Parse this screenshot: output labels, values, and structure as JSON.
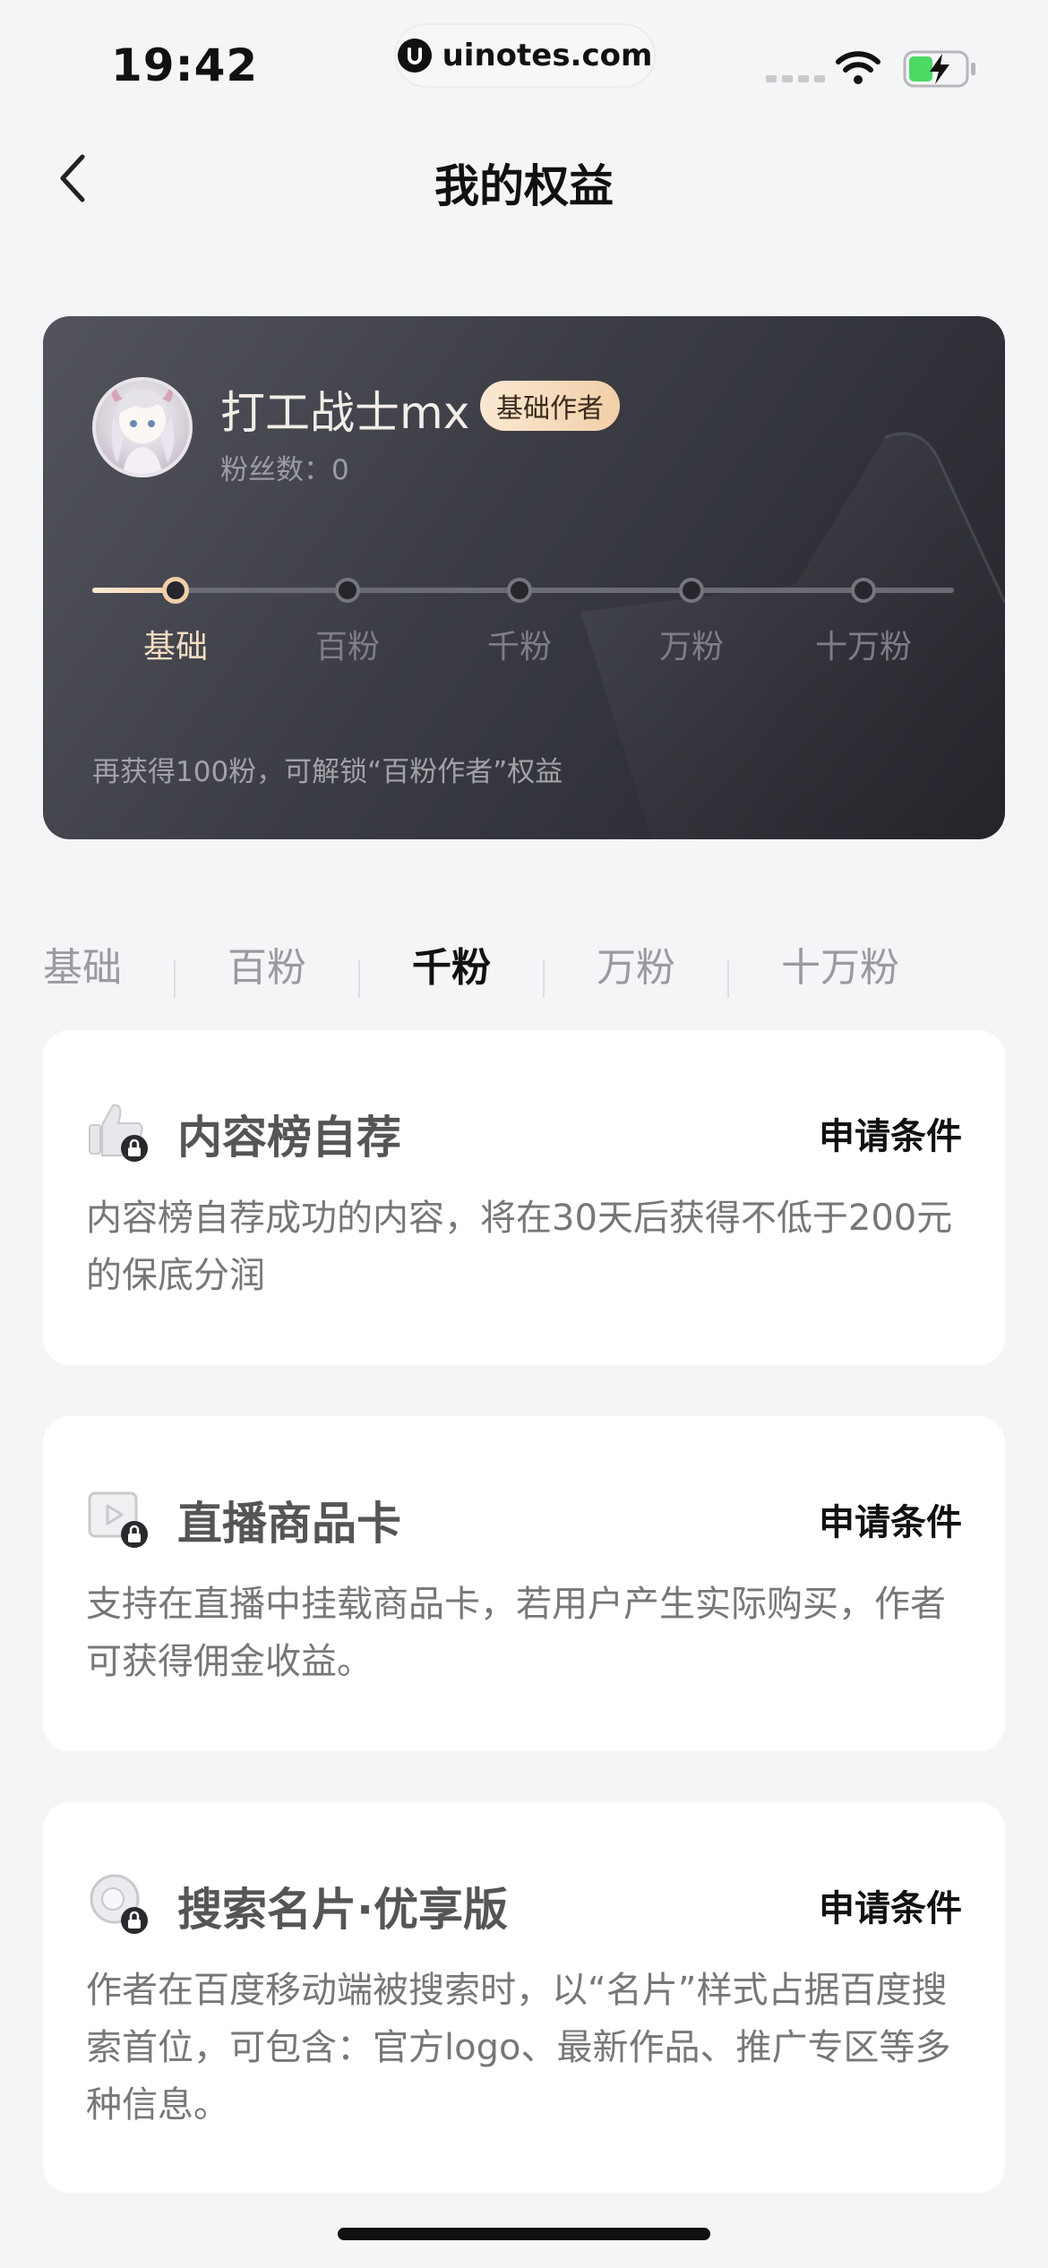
{
  "status_bar": {
    "time": "19:42",
    "url": "uinotes.com"
  },
  "nav": {
    "title": "我的权益"
  },
  "profile": {
    "name": "打工战士mx",
    "badge": "基础作者",
    "fans_label": "粉丝数：",
    "fans_count": "0",
    "progress_fraction": 0.1,
    "levels": [
      "基础",
      "百粉",
      "千粉",
      "万粉",
      "十万粉"
    ],
    "current_level_index": 0,
    "hint": "再获得100粉，可解锁“百粉作者”权益"
  },
  "tabs": {
    "items": [
      "基础",
      "百粉",
      "千粉",
      "万粉",
      "十万粉"
    ],
    "active_index": 2
  },
  "benefits": [
    {
      "icon": "thumbs-up-lock-icon",
      "title": "内容榜自荐",
      "action": "申请条件",
      "description": "内容榜自荐成功的内容，将在30天后获得不低于200元的保底分润"
    },
    {
      "icon": "live-play-lock-icon",
      "title": "直播商品卡",
      "action": "申请条件",
      "description": "支持在直播中挂载商品卡，若用户产生实际购买，作者可获得佣金收益。"
    },
    {
      "icon": "search-card-lock-icon",
      "title": "搜索名片·优享版",
      "action": "申请条件",
      "description": "作者在百度移动端被搜索时，以“名片”样式占据百度搜索首位，可包含：官方logo、最新作品、推广专区等多种信息。"
    }
  ],
  "colors": {
    "accent_gold": "#f1cfa8",
    "card_dark": "#3b3c44",
    "page_bg": "#f4f5f7"
  }
}
